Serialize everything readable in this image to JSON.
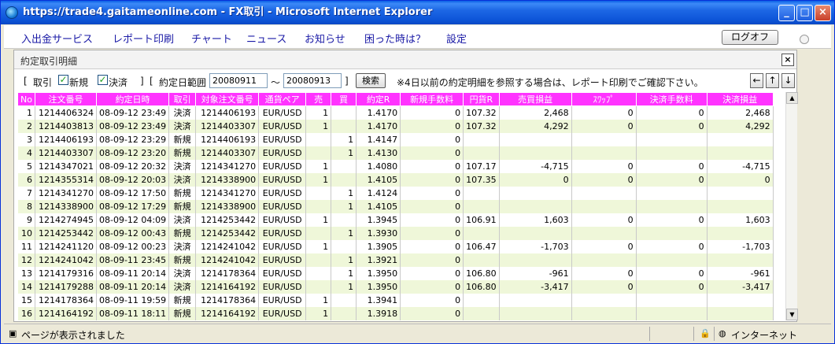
{
  "window": {
    "title": "https://trade4.gaitameonline.com - FX取引 - Microsoft Internet Explorer",
    "minimize": "_",
    "maximize": "□",
    "close": "×"
  },
  "menu": {
    "items": [
      "入出金サービス",
      "レポート印刷",
      "チャート",
      "ニュース",
      "お知らせ",
      "困った時は？",
      "設定"
    ],
    "logoff": "ログオフ"
  },
  "panel": {
    "title": "約定取引明細",
    "close": "×"
  },
  "filter": {
    "open_bracket": "[",
    "torihiki": "取引",
    "new_label": "新規",
    "new_checked": true,
    "settle_label": "決済",
    "settle_checked": true,
    "close_bracket1": "]",
    "open_bracket2": "[",
    "date_range_label": "約定日範囲",
    "date_from": "20080911",
    "tilde": "～",
    "date_to": "20080913",
    "close_bracket2": "]",
    "search": "検索",
    "note": "※4日以前の約定明細を参照する場合は、レポート印刷でご確認下さい。",
    "arrows": [
      "←",
      "↑",
      "↓"
    ]
  },
  "table": {
    "headers": [
      "No",
      "注文番号",
      "約定日時",
      "取引",
      "対象注文番号",
      "通貨ペア",
      "売",
      "買",
      "約定R",
      "新規手数料",
      "円貨R",
      "売買損益",
      "ｽﾜｯﾌﾟ",
      "決済手数料",
      "決済損益"
    ],
    "rows": [
      [
        "1",
        "1214406324",
        "08-09-12 23:49",
        "決済",
        "1214406193",
        "EUR/USD",
        "1",
        "",
        "1.4170",
        "0",
        "107.32",
        "2,468",
        "0",
        "0",
        "2,468"
      ],
      [
        "2",
        "1214403813",
        "08-09-12 23:49",
        "決済",
        "1214403307",
        "EUR/USD",
        "1",
        "",
        "1.4170",
        "0",
        "107.32",
        "4,292",
        "0",
        "0",
        "4,292"
      ],
      [
        "3",
        "1214406193",
        "08-09-12 23:29",
        "新規",
        "1214406193",
        "EUR/USD",
        "",
        "1",
        "1.4147",
        "0",
        "",
        "",
        "",
        "",
        ""
      ],
      [
        "4",
        "1214403307",
        "08-09-12 23:20",
        "新規",
        "1214403307",
        "EUR/USD",
        "",
        "1",
        "1.4130",
        "0",
        "",
        "",
        "",
        "",
        ""
      ],
      [
        "5",
        "1214347021",
        "08-09-12 20:32",
        "決済",
        "1214341270",
        "EUR/USD",
        "1",
        "",
        "1.4080",
        "0",
        "107.17",
        "-4,715",
        "0",
        "0",
        "-4,715"
      ],
      [
        "6",
        "1214355314",
        "08-09-12 20:03",
        "決済",
        "1214338900",
        "EUR/USD",
        "1",
        "",
        "1.4105",
        "0",
        "107.35",
        "0",
        "0",
        "0",
        "0"
      ],
      [
        "7",
        "1214341270",
        "08-09-12 17:50",
        "新規",
        "1214341270",
        "EUR/USD",
        "",
        "1",
        "1.4124",
        "0",
        "",
        "",
        "",
        "",
        ""
      ],
      [
        "8",
        "1214338900",
        "08-09-12 17:29",
        "新規",
        "1214338900",
        "EUR/USD",
        "",
        "1",
        "1.4105",
        "0",
        "",
        "",
        "",
        "",
        ""
      ],
      [
        "9",
        "1214274945",
        "08-09-12 04:09",
        "決済",
        "1214253442",
        "EUR/USD",
        "1",
        "",
        "1.3945",
        "0",
        "106.91",
        "1,603",
        "0",
        "0",
        "1,603"
      ],
      [
        "10",
        "1214253442",
        "08-09-12 00:43",
        "新規",
        "1214253442",
        "EUR/USD",
        "",
        "1",
        "1.3930",
        "0",
        "",
        "",
        "",
        "",
        ""
      ],
      [
        "11",
        "1214241120",
        "08-09-12 00:23",
        "決済",
        "1214241042",
        "EUR/USD",
        "1",
        "",
        "1.3905",
        "0",
        "106.47",
        "-1,703",
        "0",
        "0",
        "-1,703"
      ],
      [
        "12",
        "1214241042",
        "08-09-11 23:45",
        "新規",
        "1214241042",
        "EUR/USD",
        "",
        "1",
        "1.3921",
        "0",
        "",
        "",
        "",
        "",
        ""
      ],
      [
        "13",
        "1214179316",
        "08-09-11 20:14",
        "決済",
        "1214178364",
        "EUR/USD",
        "",
        "1",
        "1.3950",
        "0",
        "106.80",
        "-961",
        "0",
        "0",
        "-961"
      ],
      [
        "14",
        "1214179288",
        "08-09-11 20:14",
        "決済",
        "1214164192",
        "EUR/USD",
        "",
        "1",
        "1.3950",
        "0",
        "106.80",
        "-3,417",
        "0",
        "0",
        "-3,417"
      ],
      [
        "15",
        "1214178364",
        "08-09-11 19:59",
        "新規",
        "1214178364",
        "EUR/USD",
        "1",
        "",
        "1.3941",
        "0",
        "",
        "",
        "",
        "",
        ""
      ],
      [
        "16",
        "1214164192",
        "08-09-11 18:11",
        "新規",
        "1214164192",
        "EUR/USD",
        "1",
        "",
        "1.3918",
        "0",
        "",
        "",
        "",
        "",
        ""
      ]
    ]
  },
  "status": {
    "text": "ページが表示されました",
    "zone": "インターネット"
  },
  "colors": {
    "header_bg": "#ff33ff",
    "row_alt": "#eff7d9",
    "menu_link": "#1a1aa6"
  }
}
